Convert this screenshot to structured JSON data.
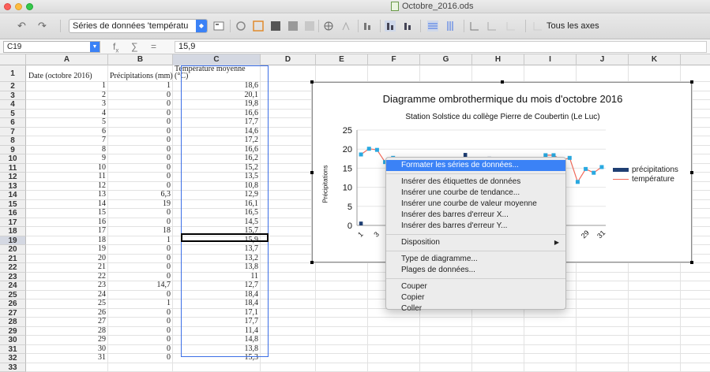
{
  "window": {
    "title": "Octobre_2016.ods"
  },
  "toolbar": {
    "series_select": "Séries de données 'températu",
    "all_axes_label": "Tous les axes"
  },
  "formula_bar": {
    "name_box": "C19",
    "formula": "15,9"
  },
  "columns": [
    "A",
    "B",
    "C",
    "D",
    "E",
    "F",
    "G",
    "H",
    "I",
    "J",
    "K"
  ],
  "selected_column": "C",
  "selected_row": "19",
  "header_row": {
    "a": "Date (octobre 2016)",
    "b": "Précipitations (mm)",
    "c1": "Température moyenne",
    "c2": "(°C)"
  },
  "rows": [
    {
      "n": "2",
      "a": "1",
      "b": "1",
      "c": "18,6"
    },
    {
      "n": "3",
      "a": "2",
      "b": "0",
      "c": "20,1"
    },
    {
      "n": "4",
      "a": "3",
      "b": "0",
      "c": "19,8"
    },
    {
      "n": "5",
      "a": "4",
      "b": "0",
      "c": "16,6"
    },
    {
      "n": "6",
      "a": "5",
      "b": "0",
      "c": "17,7"
    },
    {
      "n": "7",
      "a": "6",
      "b": "0",
      "c": "14,6"
    },
    {
      "n": "8",
      "a": "7",
      "b": "0",
      "c": "17,2"
    },
    {
      "n": "9",
      "a": "8",
      "b": "0",
      "c": "16,6"
    },
    {
      "n": "10",
      "a": "9",
      "b": "0",
      "c": "16,2"
    },
    {
      "n": "11",
      "a": "10",
      "b": "0",
      "c": "15,2"
    },
    {
      "n": "12",
      "a": "11",
      "b": "0",
      "c": "13,5"
    },
    {
      "n": "13",
      "a": "12",
      "b": "0",
      "c": "10,8"
    },
    {
      "n": "14",
      "a": "13",
      "b": "6,3",
      "c": "12,9"
    },
    {
      "n": "15",
      "a": "14",
      "b": "19",
      "c": "16,1"
    },
    {
      "n": "16",
      "a": "15",
      "b": "0",
      "c": "16,5"
    },
    {
      "n": "17",
      "a": "16",
      "b": "0",
      "c": "14,5"
    },
    {
      "n": "18",
      "a": "17",
      "b": "18",
      "c": "15,7"
    },
    {
      "n": "19",
      "a": "18",
      "b": "1",
      "c": "15,9"
    },
    {
      "n": "20",
      "a": "19",
      "b": "0",
      "c": "13,7"
    },
    {
      "n": "21",
      "a": "20",
      "b": "0",
      "c": "13,2"
    },
    {
      "n": "22",
      "a": "21",
      "b": "0",
      "c": "13,8"
    },
    {
      "n": "23",
      "a": "22",
      "b": "0",
      "c": "11"
    },
    {
      "n": "24",
      "a": "23",
      "b": "14,7",
      "c": "12,7"
    },
    {
      "n": "25",
      "a": "24",
      "b": "0",
      "c": "18,4"
    },
    {
      "n": "26",
      "a": "25",
      "b": "1",
      "c": "18,4"
    },
    {
      "n": "27",
      "a": "26",
      "b": "0",
      "c": "17,1"
    },
    {
      "n": "28",
      "a": "27",
      "b": "0",
      "c": "17,7"
    },
    {
      "n": "29",
      "a": "28",
      "b": "0",
      "c": "11,4"
    },
    {
      "n": "30",
      "a": "29",
      "b": "0",
      "c": "14,8"
    },
    {
      "n": "31",
      "a": "30",
      "b": "0",
      "c": "13,8"
    },
    {
      "n": "32",
      "a": "31",
      "b": "0",
      "c": "15,3"
    },
    {
      "n": "33",
      "a": "",
      "b": "",
      "c": ""
    }
  ],
  "chart": {
    "title": "Diagramme ombrothermique du mois d'octobre 2016",
    "subtitle": "Station Solstice du collège Pierre de Coubertin (Le Luc)",
    "ylabel": "Précipitations",
    "yticks": [
      "0",
      "5",
      "10",
      "15",
      "20",
      "25"
    ],
    "xticks_visible": [
      "1",
      "3",
      "29",
      "31"
    ],
    "legend": [
      "précipitations",
      "température"
    ],
    "colors": {
      "precip": "#1f3f73",
      "temp": "#f26b5b",
      "marker": "#29a9e1"
    }
  },
  "chart_data": {
    "type": "bar",
    "title": "Diagramme ombrothermique du mois d'octobre 2016",
    "subtitle": "Station Solstice du collège Pierre de Coubertin (Le Luc)",
    "ylabel": "Précipitations",
    "ylim": [
      0,
      25
    ],
    "x": [
      1,
      2,
      3,
      4,
      5,
      6,
      7,
      8,
      9,
      10,
      11,
      12,
      13,
      14,
      15,
      16,
      17,
      18,
      19,
      20,
      21,
      22,
      23,
      24,
      25,
      26,
      27,
      28,
      29,
      30,
      31
    ],
    "series": [
      {
        "name": "précipitations",
        "type": "bar",
        "values": [
          1,
          0,
          0,
          0,
          0,
          0,
          0,
          0,
          0,
          0,
          0,
          0,
          6.3,
          19,
          0,
          0,
          18,
          1,
          0,
          0,
          0,
          0,
          14.7,
          0,
          1,
          0,
          0,
          0,
          0,
          0,
          0
        ]
      },
      {
        "name": "température",
        "type": "line",
        "values": [
          18.6,
          20.1,
          19.8,
          16.6,
          17.7,
          14.6,
          17.2,
          16.6,
          16.2,
          15.2,
          13.5,
          10.8,
          12.9,
          16.1,
          16.5,
          14.5,
          15.7,
          15.9,
          13.7,
          13.2,
          13.8,
          11,
          12.7,
          18.4,
          18.4,
          17.1,
          17.7,
          11.4,
          14.8,
          13.8,
          15.3
        ]
      }
    ],
    "legend_position": "right"
  },
  "context_menu": {
    "items": [
      {
        "label": "Formater les séries de données...",
        "highlighted": true
      },
      {
        "sep": true
      },
      {
        "label": "Insérer des étiquettes de données"
      },
      {
        "label": "Insérer une courbe de tendance..."
      },
      {
        "label": "Insérer une courbe de valeur moyenne"
      },
      {
        "label": "Insérer des barres d'erreur X..."
      },
      {
        "label": "Insérer des barres d'erreur Y..."
      },
      {
        "sep": true
      },
      {
        "label": "Disposition",
        "submenu": true
      },
      {
        "sep": true
      },
      {
        "label": "Type de diagramme..."
      },
      {
        "label": "Plages de données..."
      },
      {
        "sep": true
      },
      {
        "label": "Couper"
      },
      {
        "label": "Copier"
      },
      {
        "label": "Coller"
      }
    ]
  }
}
